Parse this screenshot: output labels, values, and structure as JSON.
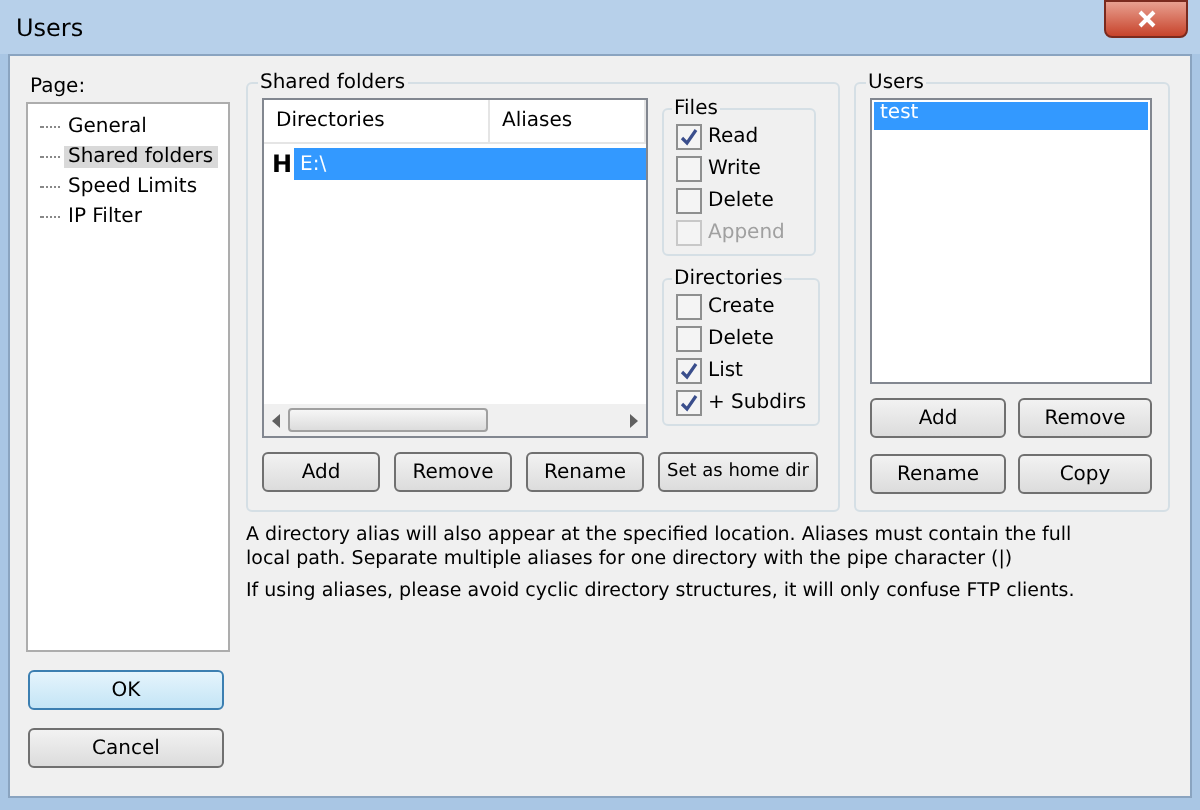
{
  "window": {
    "title": "Users"
  },
  "page_label": "Page:",
  "pages": [
    {
      "label": "General",
      "selected": false
    },
    {
      "label": "Shared folders",
      "selected": true
    },
    {
      "label": "Speed Limits",
      "selected": false
    },
    {
      "label": "IP Filter",
      "selected": false
    }
  ],
  "shared_folders": {
    "title": "Shared folders",
    "columns": [
      "Directories",
      "Aliases"
    ],
    "rows": [
      {
        "marker": "H",
        "directory": "E:\\",
        "selected": true
      }
    ],
    "buttons": [
      "Add",
      "Remove",
      "Rename",
      "Set as home dir"
    ]
  },
  "files": {
    "title": "Files",
    "options": [
      {
        "label": "Read",
        "checked": true,
        "disabled": false
      },
      {
        "label": "Write",
        "checked": false,
        "disabled": false
      },
      {
        "label": "Delete",
        "checked": false,
        "disabled": false
      },
      {
        "label": "Append",
        "checked": false,
        "disabled": true
      }
    ]
  },
  "directories": {
    "title": "Directories",
    "options": [
      {
        "label": "Create",
        "checked": false,
        "disabled": false
      },
      {
        "label": "Delete",
        "checked": false,
        "disabled": false
      },
      {
        "label": "List",
        "checked": true,
        "disabled": false
      },
      {
        "label": "+ Subdirs",
        "checked": true,
        "disabled": false
      }
    ]
  },
  "users": {
    "title": "Users",
    "items": [
      {
        "name": "test",
        "selected": true
      }
    ],
    "buttons": [
      "Add",
      "Remove",
      "Rename",
      "Copy"
    ]
  },
  "notes": [
    "A directory alias will also appear at the specified location. Aliases must contain the full local path. Separate multiple aliases for one directory with the pipe character (|)",
    "If using aliases, please avoid cyclic directory structures, it will only confuse FTP clients."
  ],
  "dialog_buttons": [
    {
      "label": "OK",
      "default": true
    },
    {
      "label": "Cancel",
      "default": false
    }
  ]
}
